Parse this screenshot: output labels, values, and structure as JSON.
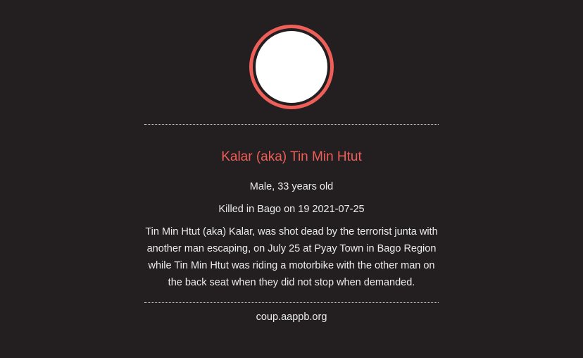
{
  "profile": {
    "name": "Kalar (aka) Tin Min Htut",
    "demographics": "Male, 33 years old",
    "death_info": "Killed in Bago on 19 2021-07-25",
    "bio": "Tin Min Htut (aka) Kalar, was shot dead by the terrorist junta with another man escaping, on July 25 at Pyay Town in Bago Region while Tin Min Htut was riding a motorbike with the other man on the back seat when they did not stop when demanded.",
    "source": "coup.aappb.org"
  },
  "colors": {
    "background": "#231f20",
    "accent": "#ef5f5a",
    "text": "#ececec",
    "avatar_fill": "#ffffff"
  }
}
